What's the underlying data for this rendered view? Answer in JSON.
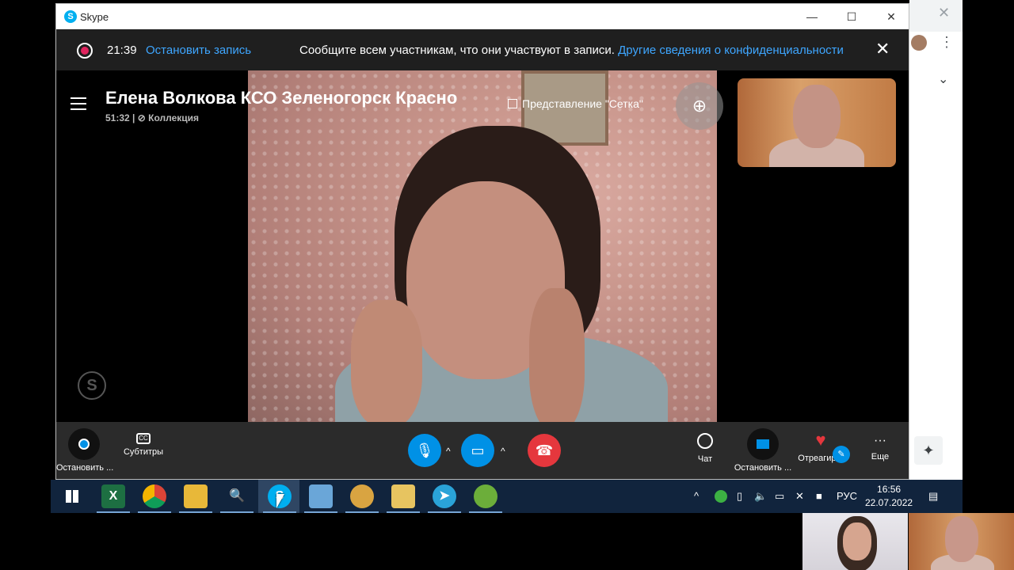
{
  "window": {
    "app_title": "Skype"
  },
  "recording": {
    "elapsed": "21:39",
    "stop_label": "Остановить запись",
    "notice": "Сообщите всем участникам, что они участвуют в записи.",
    "privacy_link": "Другие сведения о конфиденциальности"
  },
  "call": {
    "title": "Елена Волкова КСО Зеленогорск Красно",
    "duration": "51:32",
    "collection": "Коллекция",
    "view_mode": "Представление \"Сетка\""
  },
  "controls": {
    "stop_recording": "Остановить ...",
    "subtitles": "Субтитры",
    "chat": "Чат",
    "stop_share": "Остановить ...",
    "react": "Отреагир...",
    "more": "Еще"
  },
  "taskbar": {
    "language": "РУС",
    "time": "16:56",
    "date": "22.07.2022"
  },
  "colors": {
    "accent_blue": "#0091e6",
    "link_blue": "#3ea6ff",
    "end_call_red": "#e5373d",
    "record_red": "#e0245e"
  },
  "icons": [
    "skype-logo-icon",
    "record-dot-icon",
    "close-icon",
    "menu-icon",
    "grid-icon",
    "add-person-icon",
    "microphone-icon",
    "camera-icon",
    "hangup-icon",
    "chat-icon",
    "share-stop-icon",
    "heart-icon",
    "more-icon",
    "windows-start-icon",
    "excel-icon",
    "chrome-icon",
    "folder-icon",
    "search-icon",
    "skype-taskbar-icon",
    "notepad-icon",
    "paint-icon",
    "sticky-icon",
    "telegram-icon",
    "game-icon",
    "notification-icon"
  ]
}
